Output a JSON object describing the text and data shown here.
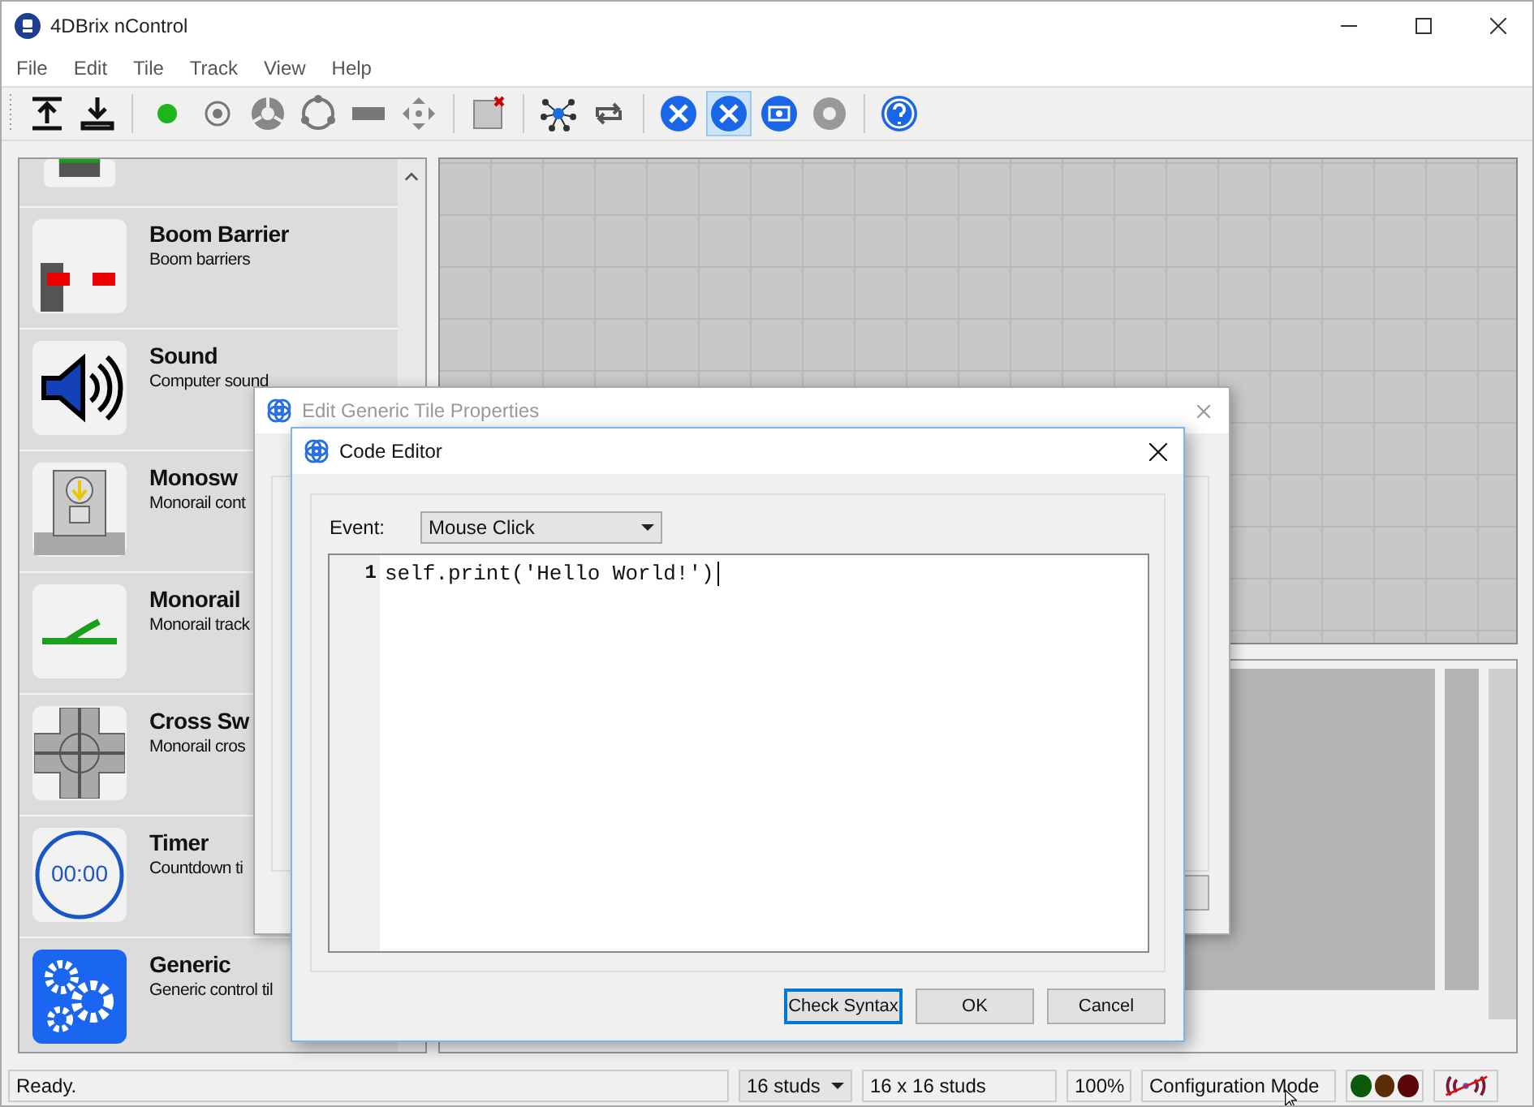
{
  "window": {
    "title": "4DBrix nControl"
  },
  "menu": [
    "File",
    "Edit",
    "Tile",
    "Track",
    "View",
    "Help"
  ],
  "toolbar": [
    [
      {
        "selected": false
      },
      {
        "selected": false
      }
    ],
    [
      {
        "selected": false
      },
      {
        "selected": false
      },
      {
        "selected": false
      },
      {
        "selected": false
      },
      {
        "selected": false
      },
      {
        "selected": false
      }
    ],
    [
      {
        "selected": false
      }
    ],
    [
      {
        "selected": false
      },
      {
        "selected": false
      }
    ],
    [
      {
        "selected": false
      },
      {
        "selected": true
      },
      {
        "selected": false
      },
      {
        "selected": false
      }
    ],
    [
      {
        "selected": false
      }
    ]
  ],
  "tiles": [
    {
      "title": "Boom Barrier",
      "subtitle": "Boom barriers"
    },
    {
      "title": "Sound",
      "subtitle": "Computer sound"
    },
    {
      "title": "Monosw",
      "subtitle": "Monorail cont"
    },
    {
      "title": "Monorail",
      "subtitle": "Monorail track"
    },
    {
      "title": "Cross Sw",
      "subtitle": "Monorail cros"
    },
    {
      "title": "Timer",
      "subtitle": "Countdown ti",
      "icon_text": "00:00"
    },
    {
      "title": "Generic",
      "subtitle": "Generic control til"
    }
  ],
  "properties_dialog": {
    "title": "Edit Generic Tile Properties"
  },
  "code_editor": {
    "title": "Code Editor",
    "event_label": "Event:",
    "event": "Mouse Click",
    "lines": [
      {
        "number": "1",
        "code": "self.print('Hello World!')"
      }
    ],
    "buttons": [
      {
        "label": "Check Syntax",
        "focused": true
      },
      {
        "label": "OK",
        "focused": false
      },
      {
        "label": "Cancel",
        "focused": false
      }
    ]
  },
  "status_bar": {
    "message": "Ready.",
    "stud_size": "16 studs",
    "grid_size": "16 x 16 studs",
    "zoom": "100%",
    "mode": "Configuration Mode",
    "lights": [
      {
        "color": "#0b5a0b"
      },
      {
        "color": "#5c2d06"
      },
      {
        "color": "#5a0606"
      }
    ]
  }
}
